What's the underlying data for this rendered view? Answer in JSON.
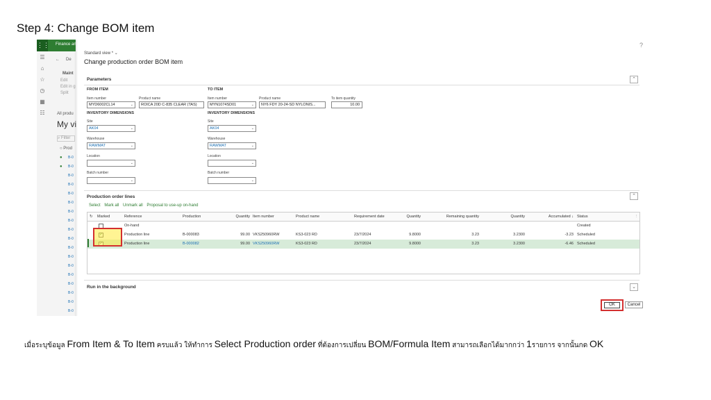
{
  "slide": {
    "title": "Step 4: Change BOM item"
  },
  "background_app": {
    "app_name": "Finance an",
    "frag_de": "De",
    "frag_maint": "Maint",
    "frag_edit1": "Edit",
    "frag_edit2": "Edit in g",
    "frag_split": "Split",
    "frag_allprod": "All produ",
    "frag_myview": "My vi",
    "frag_filter": "Filter",
    "frag_prod": "Prod",
    "row_prefix": "B-0"
  },
  "dialog": {
    "standard_view": "Standard view *",
    "title": "Change production order BOM item",
    "help": "?",
    "parameters": {
      "heading": "Parameters",
      "from_item": {
        "group": "FROM ITEM",
        "item_number_label": "Item number",
        "item_number": "MYD6002CL14",
        "product_name_label": "Product name",
        "product_name": "ROICA 20D C-835 CLEAR (TAS)"
      },
      "to_item": {
        "group": "TO ITEM",
        "item_number_label": "Item number",
        "item_number": "MYN1074SD01",
        "product_name_label": "Product name",
        "product_name": "NY6 FDY 20-24-SD NYLONIS...",
        "to_qty_label": "To item quantity",
        "to_qty": "10.00"
      },
      "inv_dims_label": "INVENTORY DIMENSIONS",
      "from_dims": {
        "site_label": "Site",
        "site": "AK04",
        "warehouse_label": "Warehouse",
        "warehouse": "RAWMAT",
        "location_label": "Location",
        "location": "",
        "batch_label": "Batch number",
        "batch": ""
      },
      "to_dims": {
        "site_label": "Site",
        "site": "AK04",
        "warehouse_label": "Warehouse",
        "warehouse": "RAWMAT",
        "location_label": "Location",
        "location": "",
        "batch_label": "Batch number",
        "batch": ""
      }
    },
    "lines": {
      "heading": "Production order lines",
      "actions": [
        "Select",
        "Mark all",
        "Unmark all",
        "Proposal to use-up on-hand"
      ],
      "columns": {
        "marked": "Marked",
        "reference": "Reference",
        "production": "Production",
        "quantity1": "Quantity",
        "item_number": "Item number",
        "product_name": "Product name",
        "requirement_date": "Requirement date",
        "quantity2": "Quantity",
        "remaining_quantity": "Remaining quantity",
        "quantity3": "Quantity",
        "accumulated": "Accumulated ↓",
        "status": "Status"
      },
      "rows": [
        {
          "marked": false,
          "reference": "On-hand",
          "production": "",
          "quantity1": "",
          "item_number": "",
          "product_name": "",
          "requirement_date": "",
          "quantity2": "",
          "remaining_quantity": "",
          "quantity3": "",
          "accumulated": "",
          "status": "Created"
        },
        {
          "marked": true,
          "reference": "Production line",
          "production": "B-000083",
          "quantity1": "99.00",
          "item_number": "VKS250960RW",
          "product_name": "KS3-023 RD",
          "requirement_date": "23/7/2024",
          "quantity2": "9.8000",
          "remaining_quantity": "3.23",
          "quantity3": "3.2300",
          "accumulated": "-3.23",
          "status": "Scheduled"
        },
        {
          "marked": true,
          "reference": "Production line",
          "production": "B-000082",
          "quantity1": "99.00",
          "item_number": "VKS250960RW",
          "product_name": "KS3-023 RD",
          "requirement_date": "23/7/2024",
          "quantity2": "9.8000",
          "remaining_quantity": "3.23",
          "quantity3": "3.2300",
          "accumulated": "-6.46",
          "status": "Scheduled"
        }
      ]
    },
    "run_in_background": "Run in the background",
    "ok_label": "OK",
    "cancel_label": "Cancel"
  },
  "caption": {
    "part1": "เมื่อระบุข้อมูล ",
    "part2": "From Item & To Item",
    "part3": " ครบแล้ว ให้ทำการ ",
    "part4": "Select Production order",
    "part5": " ที่ต้องการเปลี่ยน ",
    "part6": "BOM/Formula Item",
    "part7": " สามารถเลือกได้มากกว่า ",
    "part8": "1",
    "part9": "รายการ จากนั้นกด ",
    "part10": "OK"
  },
  "colors": {
    "highlight_border": "#d32f2f",
    "highlight_fill": "#ffeb3b",
    "selected_row": "#d7ebd9",
    "app_green": "#2e7d32"
  }
}
